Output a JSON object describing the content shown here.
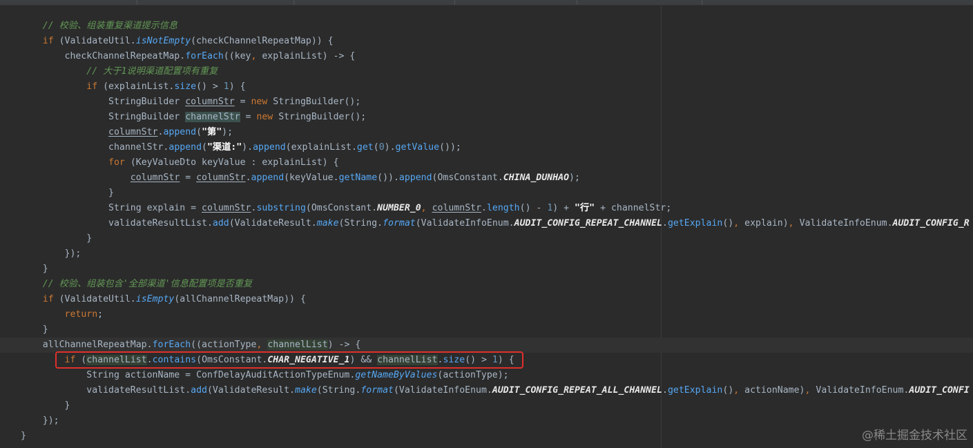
{
  "editor": {
    "colors": {
      "background": "#2b2b2b",
      "keyword": "#cc7832",
      "method": "#56a8f5",
      "comment": "#629755",
      "constant": "#e8e8e8",
      "number": "#6897bb",
      "highlight_box": "#e0302b"
    },
    "lines": [
      [
        {
          "c": "cmt",
          "t": "    // 校验、组装重复渠道提示信息"
        }
      ],
      [
        {
          "c": "",
          "t": "    "
        },
        {
          "c": "kw",
          "t": "if"
        },
        {
          "c": "",
          "t": " (ValidateUtil."
        },
        {
          "c": "static-fn",
          "t": "isNotEmpty"
        },
        {
          "c": "",
          "t": "(checkChannelRepeatMap)) {"
        }
      ],
      [
        {
          "c": "",
          "t": "        checkChannelRepeatMap."
        },
        {
          "c": "fn",
          "t": "forEach"
        },
        {
          "c": "",
          "t": "((key"
        },
        {
          "c": "kw",
          "t": ","
        },
        {
          "c": "",
          "t": " explainList) -> {"
        }
      ],
      [
        {
          "c": "cmt",
          "t": "            // 大于1说明渠道配置项有重复"
        }
      ],
      [
        {
          "c": "",
          "t": "            "
        },
        {
          "c": "kw",
          "t": "if"
        },
        {
          "c": "",
          "t": " (explainList."
        },
        {
          "c": "fn",
          "t": "size"
        },
        {
          "c": "",
          "t": "() > "
        },
        {
          "c": "num",
          "t": "1"
        },
        {
          "c": "",
          "t": ") {"
        }
      ],
      [
        {
          "c": "",
          "t": "                StringBuilder "
        },
        {
          "c": "var-ul",
          "t": "columnStr"
        },
        {
          "c": "",
          "t": " = "
        },
        {
          "c": "kw",
          "t": "new"
        },
        {
          "c": "",
          "t": " StringBuilder();"
        }
      ],
      [
        {
          "c": "",
          "t": "                StringBuilder "
        },
        {
          "c": "var-hl",
          "t": "channelStr"
        },
        {
          "c": "",
          "t": " = "
        },
        {
          "c": "kw",
          "t": "new"
        },
        {
          "c": "",
          "t": " StringBuilder();"
        }
      ],
      [
        {
          "c": "",
          "t": "                "
        },
        {
          "c": "var-ul",
          "t": "columnStr"
        },
        {
          "c": "",
          "t": "."
        },
        {
          "c": "fn",
          "t": "append"
        },
        {
          "c": "",
          "t": "("
        },
        {
          "c": "strzh",
          "t": "\"第\""
        },
        {
          "c": "",
          "t": ");"
        }
      ],
      [
        {
          "c": "",
          "t": "                channelStr."
        },
        {
          "c": "fn",
          "t": "append"
        },
        {
          "c": "",
          "t": "("
        },
        {
          "c": "strzh",
          "t": "\"渠道:\""
        },
        {
          "c": "",
          "t": ")."
        },
        {
          "c": "fn",
          "t": "append"
        },
        {
          "c": "",
          "t": "(explainList."
        },
        {
          "c": "fn",
          "t": "get"
        },
        {
          "c": "",
          "t": "("
        },
        {
          "c": "num",
          "t": "0"
        },
        {
          "c": "",
          "t": ")."
        },
        {
          "c": "fn",
          "t": "getValue"
        },
        {
          "c": "",
          "t": "());"
        }
      ],
      [
        {
          "c": "",
          "t": "                "
        },
        {
          "c": "kw",
          "t": "for"
        },
        {
          "c": "",
          "t": " (KeyValueDto keyValue : explainList) {"
        }
      ],
      [
        {
          "c": "",
          "t": "                    "
        },
        {
          "c": "var-ul",
          "t": "columnStr"
        },
        {
          "c": "",
          "t": " = "
        },
        {
          "c": "var-ul",
          "t": "columnStr"
        },
        {
          "c": "",
          "t": "."
        },
        {
          "c": "fn",
          "t": "append"
        },
        {
          "c": "",
          "t": "(keyValue."
        },
        {
          "c": "fn",
          "t": "getName"
        },
        {
          "c": "",
          "t": "())."
        },
        {
          "c": "fn",
          "t": "append"
        },
        {
          "c": "",
          "t": "(OmsConstant."
        },
        {
          "c": "const-w",
          "t": "CHINA_DUNHAO"
        },
        {
          "c": "",
          "t": ");"
        }
      ],
      [
        {
          "c": "",
          "t": "                }"
        }
      ],
      [
        {
          "c": "",
          "t": "                String explain = "
        },
        {
          "c": "var-ul",
          "t": "columnStr"
        },
        {
          "c": "",
          "t": "."
        },
        {
          "c": "fn",
          "t": "substring"
        },
        {
          "c": "",
          "t": "(OmsConstant."
        },
        {
          "c": "const-w",
          "t": "NUMBER_0"
        },
        {
          "c": "kw",
          "t": ","
        },
        {
          "c": "",
          "t": " "
        },
        {
          "c": "var-ul",
          "t": "columnStr"
        },
        {
          "c": "",
          "t": "."
        },
        {
          "c": "fn",
          "t": "length"
        },
        {
          "c": "",
          "t": "() - "
        },
        {
          "c": "num",
          "t": "1"
        },
        {
          "c": "",
          "t": ") + "
        },
        {
          "c": "strzh",
          "t": "\"行\""
        },
        {
          "c": "",
          "t": " + channelStr;"
        }
      ],
      [
        {
          "c": "",
          "t": "                validateResultList."
        },
        {
          "c": "fn",
          "t": "add"
        },
        {
          "c": "",
          "t": "(ValidateResult."
        },
        {
          "c": "static-fn",
          "t": "make"
        },
        {
          "c": "",
          "t": "(String."
        },
        {
          "c": "static-fn",
          "t": "format"
        },
        {
          "c": "",
          "t": "(ValidateInfoEnum."
        },
        {
          "c": "const-w",
          "t": "AUDIT_CONFIG_REPEAT_CHANNEL"
        },
        {
          "c": "",
          "t": "."
        },
        {
          "c": "fn",
          "t": "getExplain"
        },
        {
          "c": "",
          "t": "()"
        },
        {
          "c": "kw",
          "t": ","
        },
        {
          "c": "",
          "t": " explain)"
        },
        {
          "c": "kw",
          "t": ","
        },
        {
          "c": "",
          "t": " ValidateInfoEnum."
        },
        {
          "c": "const-w",
          "t": "AUDIT_CONFIG_R"
        }
      ],
      [
        {
          "c": "",
          "t": "            }"
        }
      ],
      [
        {
          "c": "",
          "t": "        });"
        }
      ],
      [
        {
          "c": "",
          "t": "    }"
        }
      ],
      [
        {
          "c": "cmt",
          "t": "    // 校验、组装包含'全部渠道'信息配置项是否重复"
        }
      ],
      [
        {
          "c": "",
          "t": "    "
        },
        {
          "c": "kw",
          "t": "if"
        },
        {
          "c": "",
          "t": " (ValidateUtil."
        },
        {
          "c": "static-fn",
          "t": "isEmpty"
        },
        {
          "c": "",
          "t": "(allChannelRepeatMap)) {"
        }
      ],
      [
        {
          "c": "",
          "t": "        "
        },
        {
          "c": "kw",
          "t": "return"
        },
        {
          "c": "",
          "t": ";"
        }
      ],
      [
        {
          "c": "",
          "t": "    }"
        }
      ],
      [
        {
          "c": "",
          "t": "    allChannelRepeatMap."
        },
        {
          "c": "fn",
          "t": "forEach"
        },
        {
          "c": "",
          "t": "((actionType"
        },
        {
          "c": "kw",
          "t": ","
        },
        {
          "c": "",
          "t": " "
        },
        {
          "c": "param-hl",
          "t": "channelList"
        },
        {
          "c": "",
          "t": ") -> {"
        }
      ],
      [
        {
          "c": "",
          "t": "        "
        },
        {
          "c": "kw",
          "t": "if"
        },
        {
          "c": "",
          "t": " ("
        },
        {
          "c": "param-hl",
          "t": "channelList"
        },
        {
          "c": "",
          "t": "."
        },
        {
          "c": "fn",
          "t": "contains"
        },
        {
          "c": "",
          "t": "(OmsConstant."
        },
        {
          "c": "const-w",
          "t": "CHAR_NEGATIVE_1"
        },
        {
          "c": "",
          "t": ") && "
        },
        {
          "c": "param-hl",
          "t": "channelList"
        },
        {
          "c": "",
          "t": "."
        },
        {
          "c": "fn",
          "t": "size"
        },
        {
          "c": "",
          "t": "() > "
        },
        {
          "c": "num",
          "t": "1"
        },
        {
          "c": "",
          "t": ") {"
        }
      ],
      [
        {
          "c": "",
          "t": "            String actionName = ConfDelayAuditActionTypeEnum."
        },
        {
          "c": "static-fn",
          "t": "getNameByValues"
        },
        {
          "c": "",
          "t": "(actionType);"
        }
      ],
      [
        {
          "c": "",
          "t": "            validateResultList."
        },
        {
          "c": "fn",
          "t": "add"
        },
        {
          "c": "",
          "t": "(ValidateResult."
        },
        {
          "c": "static-fn",
          "t": "make"
        },
        {
          "c": "",
          "t": "(String."
        },
        {
          "c": "static-fn",
          "t": "format"
        },
        {
          "c": "",
          "t": "(ValidateInfoEnum."
        },
        {
          "c": "const-w",
          "t": "AUDIT_CONFIG_REPEAT_ALL_CHANNEL"
        },
        {
          "c": "",
          "t": "."
        },
        {
          "c": "fn",
          "t": "getExplain"
        },
        {
          "c": "",
          "t": "()"
        },
        {
          "c": "kw",
          "t": ","
        },
        {
          "c": "",
          "t": " actionName)"
        },
        {
          "c": "kw",
          "t": ","
        },
        {
          "c": "",
          "t": " ValidateInfoEnum."
        },
        {
          "c": "const-w",
          "t": "AUDIT_CONFI"
        }
      ],
      [
        {
          "c": "",
          "t": "        }"
        }
      ],
      [
        {
          "c": "",
          "t": "    });"
        }
      ],
      [
        {
          "c": "",
          "t": "}"
        }
      ]
    ],
    "current_line_index": 21
  },
  "watermark": {
    "text": "@稀土掘金技术社区"
  }
}
